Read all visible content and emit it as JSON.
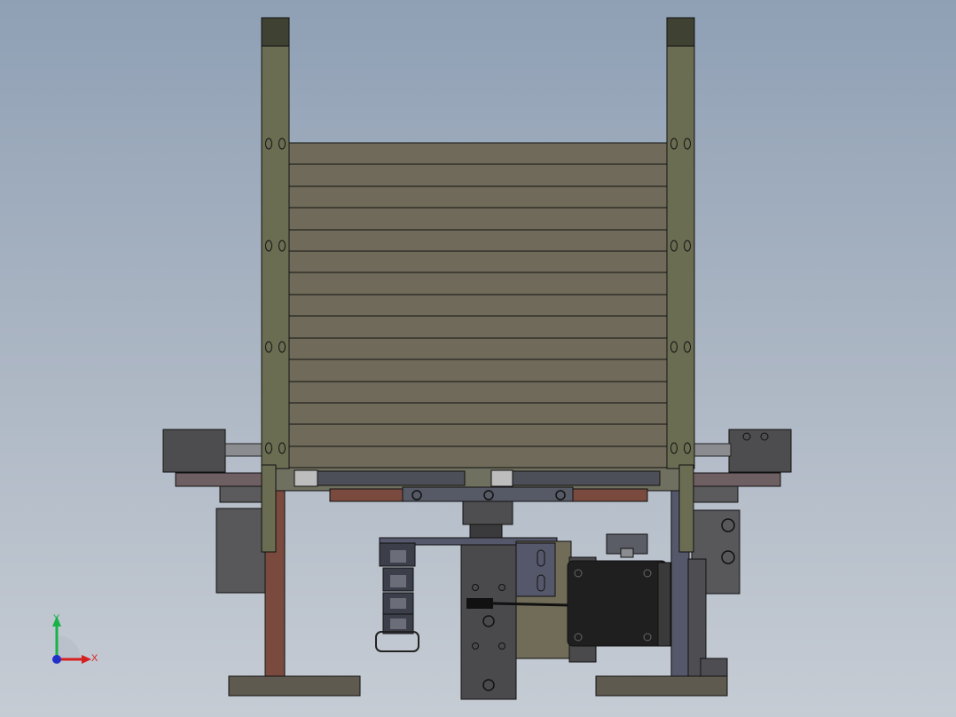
{
  "viewport": {
    "background_top": "#8fa0b5",
    "background_bottom": "#c6ccd4"
  },
  "colors": {
    "olive_frame": "#6b6d52",
    "olive_frame_dark": "#3f4232",
    "slat_fill": "#6f6a59",
    "rust": "#7a4a3f",
    "motor": "#1f1f1f",
    "steel": "#5a5a5c",
    "slate_bracket": "#55586b"
  },
  "triad": {
    "x_label": "X",
    "y_label": "Y",
    "x_color": "#d62020",
    "y_color": "#19b24a",
    "z_color": "#2030c8"
  }
}
